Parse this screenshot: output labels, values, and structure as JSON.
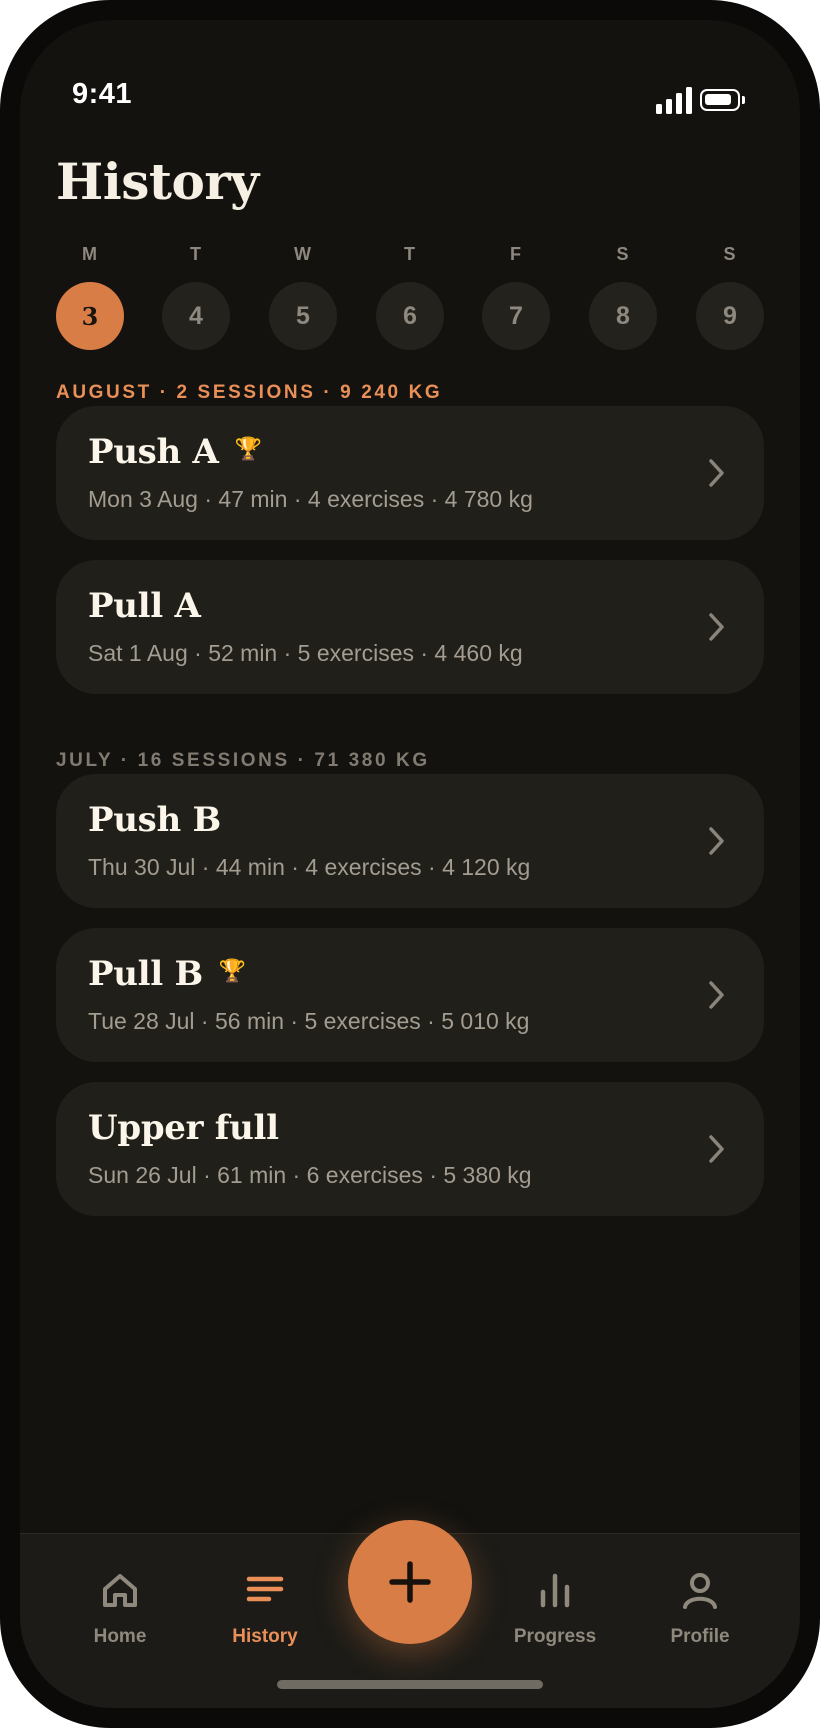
{
  "status_bar": {
    "time": "9:41"
  },
  "page_title": "History",
  "week": {
    "days": [
      {
        "letter": "M",
        "date": "3",
        "selected": true
      },
      {
        "letter": "T",
        "date": "4",
        "selected": false
      },
      {
        "letter": "W",
        "date": "5",
        "selected": false
      },
      {
        "letter": "T",
        "date": "6",
        "selected": false
      },
      {
        "letter": "F",
        "date": "7",
        "selected": false
      },
      {
        "letter": "S",
        "date": "8",
        "selected": false
      },
      {
        "letter": "S",
        "date": "9",
        "selected": false
      }
    ]
  },
  "months": [
    {
      "header": "AUGUST · 2 SESSIONS · 9 240 KG",
      "sessions": [
        {
          "name": "Push A",
          "trophy": true,
          "meta": "Mon 3 Aug · 47 min · 4 exercises · 4 780 kg"
        },
        {
          "name": "Pull A",
          "trophy": false,
          "meta": "Sat 1 Aug · 52 min · 5 exercises · 4 460 kg"
        }
      ]
    },
    {
      "header": "JULY · 16 SESSIONS · 71 380 KG",
      "sessions": [
        {
          "name": "Push B",
          "trophy": false,
          "meta": "Thu 30 Jul · 44 min · 4 exercises · 4 120 kg"
        },
        {
          "name": "Pull B",
          "trophy": true,
          "meta": "Tue 28 Jul · 56 min · 5 exercises · 5 010 kg"
        },
        {
          "name": "Upper full",
          "trophy": false,
          "meta": "Sun 26 Jul · 61 min · 6 exercises · 5 380 kg"
        }
      ]
    }
  ],
  "tab_bar": {
    "home": {
      "label": "Home",
      "icon": "home-icon"
    },
    "history": {
      "label": "History",
      "icon": "history-list-icon",
      "active": true
    },
    "add": {
      "icon": "plus-icon"
    },
    "progress": {
      "label": "Progress",
      "icon": "bar-chart-icon"
    },
    "profile": {
      "label": "Profile",
      "icon": "person-icon"
    }
  },
  "icons": {
    "trophy": "🏆",
    "chevron": "chevron-right-icon"
  },
  "colors": {
    "accent": "#d97d46",
    "accent_text": "#e98f57",
    "background": "#13120f",
    "card": "#211f1a",
    "trophy": "#e5a02a"
  }
}
